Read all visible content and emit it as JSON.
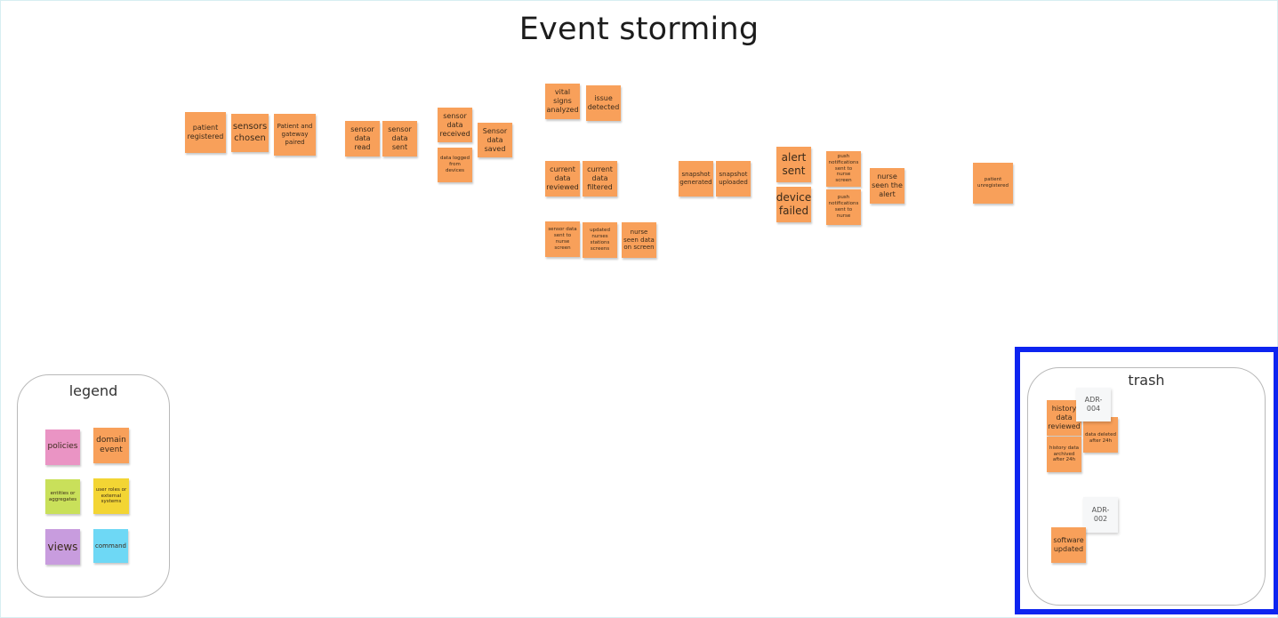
{
  "board": {
    "title": "Event storming"
  },
  "events": {
    "patient_registered": "patient registered",
    "sensors_chosen": "sensors chosen",
    "patient_gateway_paired": "Patient and gateway paired",
    "sensor_data_read": "sensor data read",
    "sensor_data_sent": "sensor data sent",
    "sensor_data_received": "sensor data received",
    "data_logged_from_devices": "data logged from devices",
    "sensor_data_saved": "Sensor data saved",
    "vital_signs_analyzed": "vital signs analyzed",
    "issue_detected": "issue detected",
    "current_data_reviewed": "current data reviewed",
    "current_data_filtered": "current data filtered",
    "sensor_data_sent_nurse": "sensor data sent to nurse screen",
    "updated_nurses_stations": "updated nurses stations screens",
    "nurse_seen_data": "nurse seen data on screen",
    "snapshot_generated": "snapshot generated",
    "snapshot_uploaded": "snapshot uploaded",
    "alert_sent": "alert sent",
    "device_failed": "device failed",
    "push_notif_nurse_screen": "push notifications sent to nurse screen",
    "push_notif_nurse": "push notifications sent to nurse",
    "nurse_seen_alert": "nurse seen the alert",
    "patient_unregistered": "patient unregistered"
  },
  "legend": {
    "label": "legend",
    "policies": "policies",
    "domain_event": "domain event",
    "entities": "entities or aggregates",
    "user_roles": "user roles or external systems",
    "views": "views",
    "command": "command"
  },
  "trash": {
    "label": "trash",
    "history_reviewed": "history data reviewed",
    "adr_004": "ADR-004",
    "data_deleted": "data deleted after 24h",
    "history_archived": "history data archived after 24h",
    "adr_002": "ADR-002",
    "software_updated": "software updated"
  },
  "colors": {
    "domain_event": "#f8a05a",
    "policies": "#ea94c4",
    "entities": "#c9e05a",
    "user_roles": "#f3d534",
    "views": "#c89cde",
    "command": "#6ed8f5",
    "selection": "#0d24f0"
  }
}
